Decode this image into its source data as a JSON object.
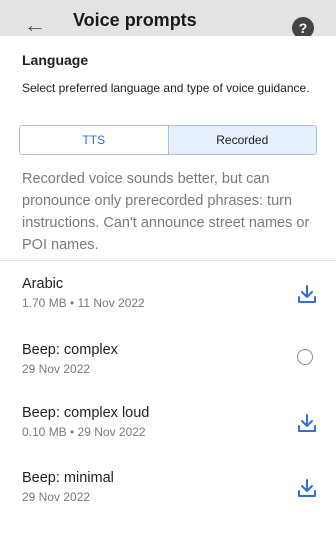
{
  "header": {
    "title": "Voice prompts",
    "back_icon": "arrow-left-icon",
    "help_icon": "question-circle-icon"
  },
  "language": {
    "title": "Language",
    "description": "Select preferred language and type of voice guidance.",
    "segments": {
      "tts": "TTS",
      "recorded": "Recorded",
      "selected": "Recorded"
    },
    "info": "Recorded voice sounds better, but can pronounce only prerecorded phrases: turn instructions. Can't announce street names or POI names."
  },
  "voices": [
    {
      "name": "Arabic",
      "meta": "1.70 MB • 11 Nov 2022",
      "action_icon": "download-icon"
    },
    {
      "name": "Beep: complex",
      "meta": "29 Nov 2022",
      "action_icon": "radio-unselected-icon"
    },
    {
      "name": "Beep: complex loud",
      "meta": "0.10 MB • 29 Nov 2022",
      "action_icon": "download-icon"
    },
    {
      "name": "Beep: minimal",
      "meta": "29 Nov 2022",
      "action_icon": "download-icon"
    }
  ],
  "colors": {
    "accent": "#2f6fd6",
    "selected_segment_bg": "#e6effa",
    "secondary_text": "#7a7a7a"
  }
}
